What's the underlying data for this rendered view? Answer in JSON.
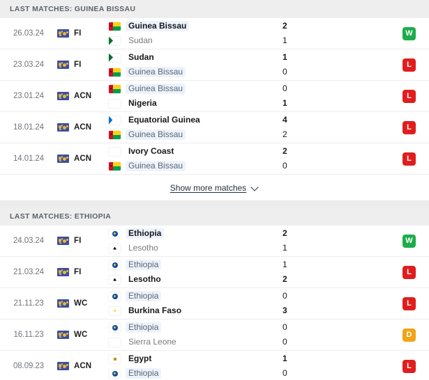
{
  "sections": [
    {
      "id": "guinea-bissau",
      "header": "LAST MATCHES: GUINEA BISSAU",
      "show_more": {
        "label": "Show more matches",
        "icon": "chevron-down-icon"
      },
      "matches": [
        {
          "date": "26.03.24",
          "competition": "FI",
          "competition_icon": "world-map-icon",
          "home": {
            "name": "Guinea Bissau",
            "flag": "guinea-bissau",
            "bold": true,
            "highlighted": true
          },
          "away": {
            "name": "Sudan",
            "flag": "sudan",
            "bold": false,
            "highlighted": false
          },
          "home_score": "2",
          "away_score": "1",
          "result": "W"
        },
        {
          "date": "23.03.24",
          "competition": "FI",
          "competition_icon": "world-map-icon",
          "home": {
            "name": "Sudan",
            "flag": "sudan",
            "bold": true,
            "highlighted": false
          },
          "away": {
            "name": "Guinea Bissau",
            "flag": "guinea-bissau",
            "bold": false,
            "highlighted": true
          },
          "home_score": "1",
          "away_score": "0",
          "result": "L"
        },
        {
          "date": "23.01.24",
          "competition": "ACN",
          "competition_icon": "world-map-icon",
          "home": {
            "name": "Guinea Bissau",
            "flag": "guinea-bissau",
            "bold": false,
            "highlighted": true
          },
          "away": {
            "name": "Nigeria",
            "flag": "nigeria",
            "bold": true,
            "highlighted": false
          },
          "home_score": "0",
          "away_score": "1",
          "result": "L"
        },
        {
          "date": "18.01.24",
          "competition": "ACN",
          "competition_icon": "world-map-icon",
          "home": {
            "name": "Equatorial Guinea",
            "flag": "eq-guinea",
            "bold": true,
            "highlighted": false
          },
          "away": {
            "name": "Guinea Bissau",
            "flag": "guinea-bissau",
            "bold": false,
            "highlighted": true
          },
          "home_score": "4",
          "away_score": "2",
          "result": "L"
        },
        {
          "date": "14.01.24",
          "competition": "ACN",
          "competition_icon": "world-map-icon",
          "home": {
            "name": "Ivory Coast",
            "flag": "ivory-coast",
            "bold": true,
            "highlighted": false
          },
          "away": {
            "name": "Guinea Bissau",
            "flag": "guinea-bissau",
            "bold": false,
            "highlighted": true
          },
          "home_score": "2",
          "away_score": "0",
          "result": "L"
        }
      ]
    },
    {
      "id": "ethiopia",
      "header": "LAST MATCHES: ETHIOPIA",
      "show_more": null,
      "matches": [
        {
          "date": "24.03.24",
          "competition": "FI",
          "competition_icon": "world-map-icon",
          "home": {
            "name": "Ethiopia",
            "flag": "ethiopia",
            "bold": true,
            "highlighted": true
          },
          "away": {
            "name": "Lesotho",
            "flag": "lesotho",
            "bold": false,
            "highlighted": false
          },
          "home_score": "2",
          "away_score": "1",
          "result": "W"
        },
        {
          "date": "21.03.24",
          "competition": "FI",
          "competition_icon": "world-map-icon",
          "home": {
            "name": "Ethiopia",
            "flag": "ethiopia",
            "bold": false,
            "highlighted": true
          },
          "away": {
            "name": "Lesotho",
            "flag": "lesotho",
            "bold": true,
            "highlighted": false
          },
          "home_score": "1",
          "away_score": "2",
          "result": "L"
        },
        {
          "date": "21.11.23",
          "competition": "WC",
          "competition_icon": "world-map-icon",
          "home": {
            "name": "Ethiopia",
            "flag": "ethiopia",
            "bold": false,
            "highlighted": true
          },
          "away": {
            "name": "Burkina Faso",
            "flag": "burkina-faso",
            "bold": true,
            "highlighted": false
          },
          "home_score": "0",
          "away_score": "3",
          "result": "L"
        },
        {
          "date": "16.11.23",
          "competition": "WC",
          "competition_icon": "world-map-icon",
          "home": {
            "name": "Ethiopia",
            "flag": "ethiopia",
            "bold": false,
            "highlighted": true
          },
          "away": {
            "name": "Sierra Leone",
            "flag": "sierra-leone",
            "bold": false,
            "highlighted": false
          },
          "home_score": "0",
          "away_score": "0",
          "result": "D"
        },
        {
          "date": "08.09.23",
          "competition": "ACN",
          "competition_icon": "world-map-icon",
          "home": {
            "name": "Egypt",
            "flag": "egypt",
            "bold": true,
            "highlighted": false
          },
          "away": {
            "name": "Ethiopia",
            "flag": "ethiopia",
            "bold": false,
            "highlighted": true
          },
          "home_score": "1",
          "away_score": "0",
          "result": "L"
        }
      ]
    }
  ],
  "colors": {
    "win": "#1cad4a",
    "loss": "#e01e1e",
    "draw": "#f0a417",
    "highlight_bg": "#edf3fc",
    "section_header_bg": "#eeeeee",
    "page_bg": "#ebebeb"
  }
}
